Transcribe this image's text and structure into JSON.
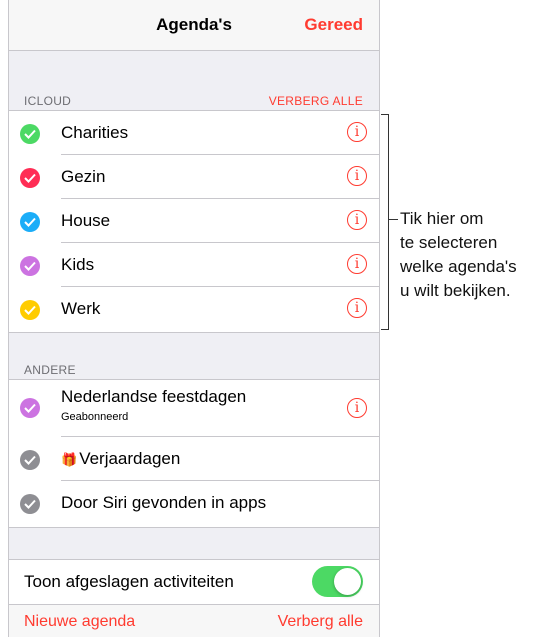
{
  "navbar": {
    "title": "Agenda's",
    "done": "Gereed"
  },
  "icloud": {
    "header": "ICLOUD",
    "action": "VERBERG ALLE",
    "items": [
      {
        "label": "Charities",
        "color": "#4cd964"
      },
      {
        "label": "Gezin",
        "color": "#ff2d55"
      },
      {
        "label": "House",
        "color": "#1badf8"
      },
      {
        "label": "Kids",
        "color": "#cc73e1"
      },
      {
        "label": "Werk",
        "color": "#ffcc00"
      }
    ]
  },
  "other": {
    "header": "ANDERE",
    "items": [
      {
        "label": "Nederlandse feestdagen",
        "sub": "Geabonneerd",
        "color": "#cc73e1"
      },
      {
        "label": "Verjaardagen",
        "color": "#8e8e93",
        "icon": "gift-icon"
      },
      {
        "label": "Door Siri gevonden in apps",
        "color": "#8e8e93"
      }
    ]
  },
  "settings": {
    "declined_label": "Toon afgeslagen activiteiten",
    "declined_on": true,
    "toggle_color": "#4cd964"
  },
  "footer": {
    "new_calendar": "Nieuwe agenda",
    "hide_all": "Verberg alle"
  },
  "callout": {
    "lines": [
      "Tik hier om",
      "te selecteren",
      "welke agenda's",
      "u wilt bekijken."
    ]
  },
  "colors": {
    "accent": "#ff3b30"
  }
}
